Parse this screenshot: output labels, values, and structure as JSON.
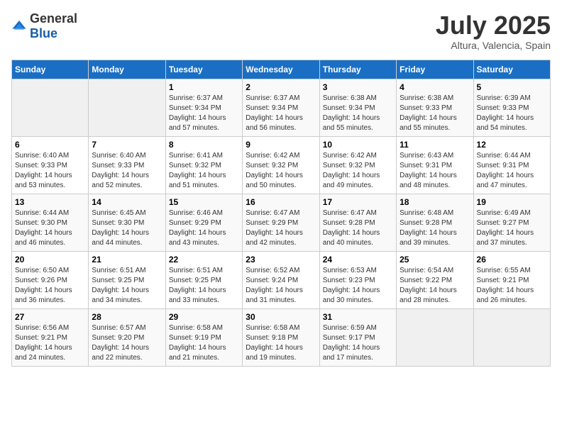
{
  "logo": {
    "general": "General",
    "blue": "Blue"
  },
  "header": {
    "title": "July 2025",
    "subtitle": "Altura, Valencia, Spain"
  },
  "days_of_week": [
    "Sunday",
    "Monday",
    "Tuesday",
    "Wednesday",
    "Thursday",
    "Friday",
    "Saturday"
  ],
  "weeks": [
    [
      {
        "day": "",
        "sunrise": "",
        "sunset": "",
        "daylight": ""
      },
      {
        "day": "",
        "sunrise": "",
        "sunset": "",
        "daylight": ""
      },
      {
        "day": "1",
        "sunrise": "Sunrise: 6:37 AM",
        "sunset": "Sunset: 9:34 PM",
        "daylight": "Daylight: 14 hours and 57 minutes."
      },
      {
        "day": "2",
        "sunrise": "Sunrise: 6:37 AM",
        "sunset": "Sunset: 9:34 PM",
        "daylight": "Daylight: 14 hours and 56 minutes."
      },
      {
        "day": "3",
        "sunrise": "Sunrise: 6:38 AM",
        "sunset": "Sunset: 9:34 PM",
        "daylight": "Daylight: 14 hours and 55 minutes."
      },
      {
        "day": "4",
        "sunrise": "Sunrise: 6:38 AM",
        "sunset": "Sunset: 9:33 PM",
        "daylight": "Daylight: 14 hours and 55 minutes."
      },
      {
        "day": "5",
        "sunrise": "Sunrise: 6:39 AM",
        "sunset": "Sunset: 9:33 PM",
        "daylight": "Daylight: 14 hours and 54 minutes."
      }
    ],
    [
      {
        "day": "6",
        "sunrise": "Sunrise: 6:40 AM",
        "sunset": "Sunset: 9:33 PM",
        "daylight": "Daylight: 14 hours and 53 minutes."
      },
      {
        "day": "7",
        "sunrise": "Sunrise: 6:40 AM",
        "sunset": "Sunset: 9:33 PM",
        "daylight": "Daylight: 14 hours and 52 minutes."
      },
      {
        "day": "8",
        "sunrise": "Sunrise: 6:41 AM",
        "sunset": "Sunset: 9:32 PM",
        "daylight": "Daylight: 14 hours and 51 minutes."
      },
      {
        "day": "9",
        "sunrise": "Sunrise: 6:42 AM",
        "sunset": "Sunset: 9:32 PM",
        "daylight": "Daylight: 14 hours and 50 minutes."
      },
      {
        "day": "10",
        "sunrise": "Sunrise: 6:42 AM",
        "sunset": "Sunset: 9:32 PM",
        "daylight": "Daylight: 14 hours and 49 minutes."
      },
      {
        "day": "11",
        "sunrise": "Sunrise: 6:43 AM",
        "sunset": "Sunset: 9:31 PM",
        "daylight": "Daylight: 14 hours and 48 minutes."
      },
      {
        "day": "12",
        "sunrise": "Sunrise: 6:44 AM",
        "sunset": "Sunset: 9:31 PM",
        "daylight": "Daylight: 14 hours and 47 minutes."
      }
    ],
    [
      {
        "day": "13",
        "sunrise": "Sunrise: 6:44 AM",
        "sunset": "Sunset: 9:30 PM",
        "daylight": "Daylight: 14 hours and 46 minutes."
      },
      {
        "day": "14",
        "sunrise": "Sunrise: 6:45 AM",
        "sunset": "Sunset: 9:30 PM",
        "daylight": "Daylight: 14 hours and 44 minutes."
      },
      {
        "day": "15",
        "sunrise": "Sunrise: 6:46 AM",
        "sunset": "Sunset: 9:29 PM",
        "daylight": "Daylight: 14 hours and 43 minutes."
      },
      {
        "day": "16",
        "sunrise": "Sunrise: 6:47 AM",
        "sunset": "Sunset: 9:29 PM",
        "daylight": "Daylight: 14 hours and 42 minutes."
      },
      {
        "day": "17",
        "sunrise": "Sunrise: 6:47 AM",
        "sunset": "Sunset: 9:28 PM",
        "daylight": "Daylight: 14 hours and 40 minutes."
      },
      {
        "day": "18",
        "sunrise": "Sunrise: 6:48 AM",
        "sunset": "Sunset: 9:28 PM",
        "daylight": "Daylight: 14 hours and 39 minutes."
      },
      {
        "day": "19",
        "sunrise": "Sunrise: 6:49 AM",
        "sunset": "Sunset: 9:27 PM",
        "daylight": "Daylight: 14 hours and 37 minutes."
      }
    ],
    [
      {
        "day": "20",
        "sunrise": "Sunrise: 6:50 AM",
        "sunset": "Sunset: 9:26 PM",
        "daylight": "Daylight: 14 hours and 36 minutes."
      },
      {
        "day": "21",
        "sunrise": "Sunrise: 6:51 AM",
        "sunset": "Sunset: 9:25 PM",
        "daylight": "Daylight: 14 hours and 34 minutes."
      },
      {
        "day": "22",
        "sunrise": "Sunrise: 6:51 AM",
        "sunset": "Sunset: 9:25 PM",
        "daylight": "Daylight: 14 hours and 33 minutes."
      },
      {
        "day": "23",
        "sunrise": "Sunrise: 6:52 AM",
        "sunset": "Sunset: 9:24 PM",
        "daylight": "Daylight: 14 hours and 31 minutes."
      },
      {
        "day": "24",
        "sunrise": "Sunrise: 6:53 AM",
        "sunset": "Sunset: 9:23 PM",
        "daylight": "Daylight: 14 hours and 30 minutes."
      },
      {
        "day": "25",
        "sunrise": "Sunrise: 6:54 AM",
        "sunset": "Sunset: 9:22 PM",
        "daylight": "Daylight: 14 hours and 28 minutes."
      },
      {
        "day": "26",
        "sunrise": "Sunrise: 6:55 AM",
        "sunset": "Sunset: 9:21 PM",
        "daylight": "Daylight: 14 hours and 26 minutes."
      }
    ],
    [
      {
        "day": "27",
        "sunrise": "Sunrise: 6:56 AM",
        "sunset": "Sunset: 9:21 PM",
        "daylight": "Daylight: 14 hours and 24 minutes."
      },
      {
        "day": "28",
        "sunrise": "Sunrise: 6:57 AM",
        "sunset": "Sunset: 9:20 PM",
        "daylight": "Daylight: 14 hours and 22 minutes."
      },
      {
        "day": "29",
        "sunrise": "Sunrise: 6:58 AM",
        "sunset": "Sunset: 9:19 PM",
        "daylight": "Daylight: 14 hours and 21 minutes."
      },
      {
        "day": "30",
        "sunrise": "Sunrise: 6:58 AM",
        "sunset": "Sunset: 9:18 PM",
        "daylight": "Daylight: 14 hours and 19 minutes."
      },
      {
        "day": "31",
        "sunrise": "Sunrise: 6:59 AM",
        "sunset": "Sunset: 9:17 PM",
        "daylight": "Daylight: 14 hours and 17 minutes."
      },
      {
        "day": "",
        "sunrise": "",
        "sunset": "",
        "daylight": ""
      },
      {
        "day": "",
        "sunrise": "",
        "sunset": "",
        "daylight": ""
      }
    ]
  ]
}
